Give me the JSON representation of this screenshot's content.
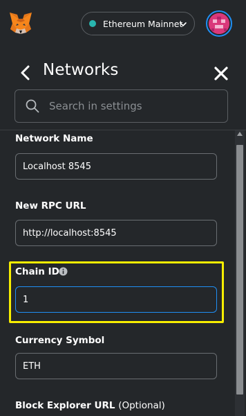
{
  "header": {
    "network_label": "Ethereum Mainnet"
  },
  "settings": {
    "title": "Networks",
    "search": {
      "placeholder": "Search in settings",
      "value": ""
    }
  },
  "form": {
    "network_name": {
      "label": "Network Name",
      "value": "Localhost 8545"
    },
    "rpc_url": {
      "label": "New RPC URL",
      "value": "http://localhost:8545"
    },
    "chain_id": {
      "label": "Chain ID",
      "value": "1"
    },
    "currency_symbol": {
      "label": "Currency Symbol",
      "value": "ETH"
    },
    "block_explorer": {
      "label": "Block Explorer URL",
      "optional": "(Optional)"
    }
  },
  "colors": {
    "background": "#24272a",
    "network_dot": "#29b6af",
    "focus_border": "#1f8ff5",
    "highlight": "#f7ee00"
  },
  "icons": [
    "metamask-fox-icon",
    "chevron-down-icon",
    "account-avatar",
    "back-arrow-icon",
    "close-icon",
    "search-icon",
    "info-icon"
  ]
}
